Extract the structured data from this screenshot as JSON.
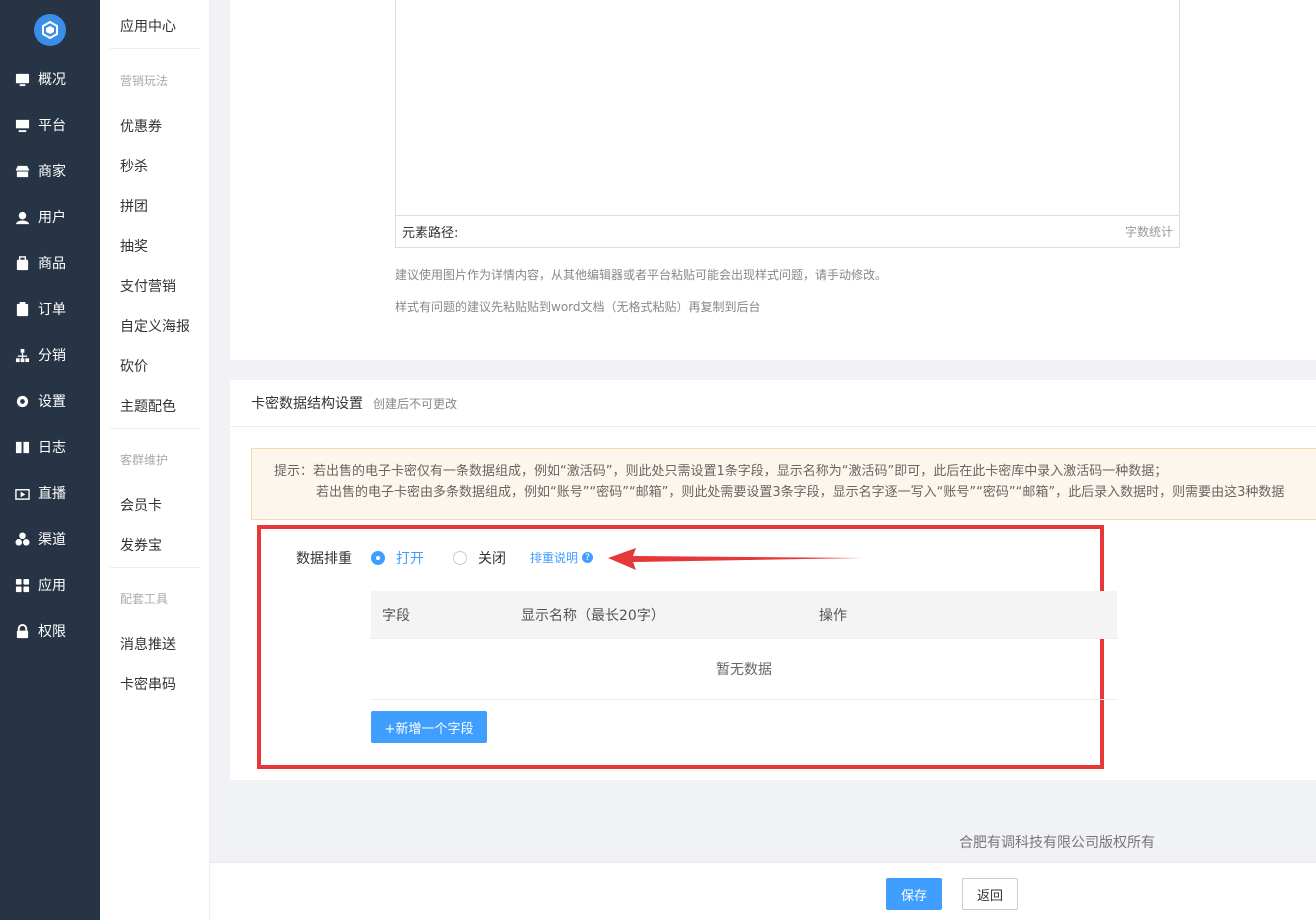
{
  "nav": {
    "items": [
      {
        "label": "概况",
        "icon": "chart-icon"
      },
      {
        "label": "平台",
        "icon": "monitor-icon"
      },
      {
        "label": "商家",
        "icon": "store-icon"
      },
      {
        "label": "用户",
        "icon": "user-icon"
      },
      {
        "label": "商品",
        "icon": "bag-icon"
      },
      {
        "label": "订单",
        "icon": "clipboard-icon"
      },
      {
        "label": "分销",
        "icon": "network-icon"
      },
      {
        "label": "设置",
        "icon": "gear-icon"
      },
      {
        "label": "日志",
        "icon": "book-icon"
      },
      {
        "label": "直播",
        "icon": "tv-icon"
      },
      {
        "label": "渠道",
        "icon": "cluster-icon"
      },
      {
        "label": "应用",
        "icon": "grid-icon"
      },
      {
        "label": "权限",
        "icon": "lock-icon"
      }
    ]
  },
  "submenu": {
    "title": "应用中心",
    "group1": "营销玩法",
    "group1_items": [
      "优惠券",
      "秒杀",
      "拼团",
      "抽奖",
      "支付营销",
      "自定义海报",
      "砍价",
      "主题配色"
    ],
    "group2": "客群维护",
    "group2_items": [
      "会员卡",
      "发券宝"
    ],
    "group3": "配套工具",
    "group3_items": [
      "消息推送",
      "卡密串码"
    ]
  },
  "editor": {
    "path_label": "元素路径:",
    "count_label": "字数统计",
    "hint1": "建议使用图片作为详情内容，从其他编辑器或者平台粘贴可能会出现样式问题，请手动修改。",
    "hint2": "样式有问题的建议先粘贴贴到word文档（无格式粘贴）再复制到后台"
  },
  "card_section": {
    "title": "卡密数据结构设置",
    "subtitle": "创建后不可更改",
    "tip_line1": "提示：若出售的电子卡密仅有一条数据组成，例如“激活码”，则此处只需设置1条字段，显示名称为“激活码”即可，此后在此卡密库中录入激活码一种数据；",
    "tip_line2": "若出售的电子卡密由多条数据组成，例如“账号”“密码”“邮箱”，则此处需要设置3条字段，显示名字逐一写入“账号”“密码”“邮箱”，此后录入数据时，则需要由这3种数据",
    "dedupe_label": "数据排重",
    "option_on": "打开",
    "option_off": "关闭",
    "dedupe_help": "排重说明",
    "help_mark": "?",
    "table": {
      "headers": [
        "字段",
        "显示名称（最长20字）",
        "操作"
      ],
      "empty": "暂无数据"
    },
    "add_button": "+新增一个字段"
  },
  "copyright": "合肥有调科技有限公司版权所有",
  "footer": {
    "save": "保存",
    "back": "返回"
  },
  "colors": {
    "nav_bg": "#263445",
    "primary": "#409eff",
    "annotation_red": "#e63838",
    "tip_bg": "#fdf6ec"
  }
}
